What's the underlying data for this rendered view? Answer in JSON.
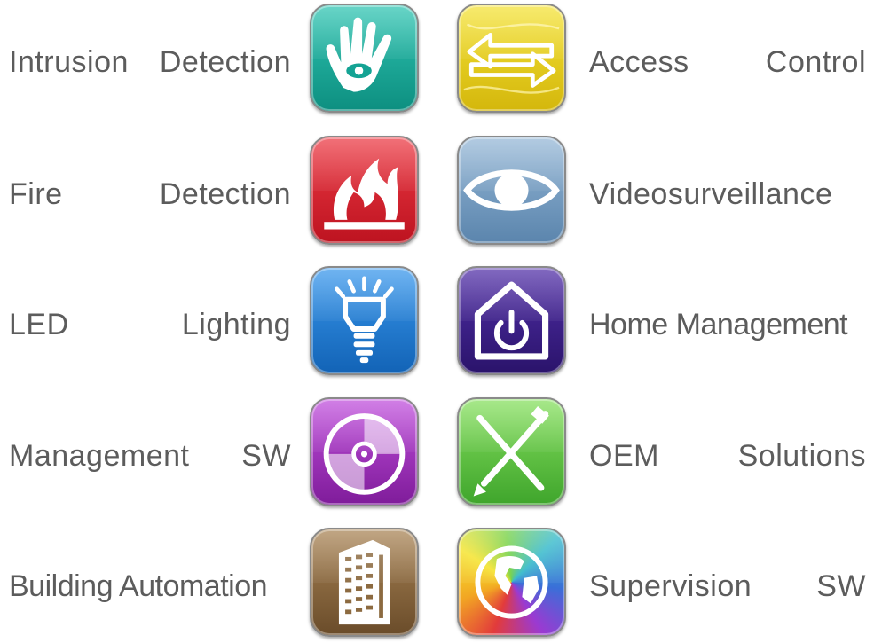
{
  "items": [
    {
      "left": {
        "label_words": [
          "Intrusion",
          "Detection"
        ],
        "icon": "hand-eye-icon",
        "color": "#14a394"
      },
      "right": {
        "label_words": [
          "Access",
          "Control"
        ],
        "icon": "arrows-exchange-icon",
        "color": "#e6d21a"
      }
    },
    {
      "left": {
        "label_words": [
          "Fire",
          "Detection"
        ],
        "icon": "flame-icon",
        "color": "#d81e2a"
      },
      "right": {
        "label_words": [
          "Videosurveillance"
        ],
        "icon": "eye-icon",
        "color": "#6e97bd"
      }
    },
    {
      "left": {
        "label_words": [
          "LED",
          "Lighting"
        ],
        "icon": "led-bulb-icon",
        "color": "#1c79d2"
      },
      "right": {
        "label_words": [
          "Home Management"
        ],
        "icon": "home-power-icon",
        "color": "#3a1f86"
      }
    },
    {
      "left": {
        "label_words": [
          "Management",
          "SW"
        ],
        "icon": "disc-icon",
        "color": "#9d2ab8"
      },
      "right": {
        "label_words": [
          "OEM",
          "Solutions"
        ],
        "icon": "tools-caliper-icon",
        "color": "#5fc444"
      }
    },
    {
      "left": {
        "label_words": [
          "Building Automation"
        ],
        "icon": "building-icon",
        "color": "#8c6a40"
      },
      "right": {
        "label_words": [
          "Supervision",
          "SW"
        ],
        "icon": "globe-icon",
        "color": "#3aa6d8"
      }
    }
  ]
}
